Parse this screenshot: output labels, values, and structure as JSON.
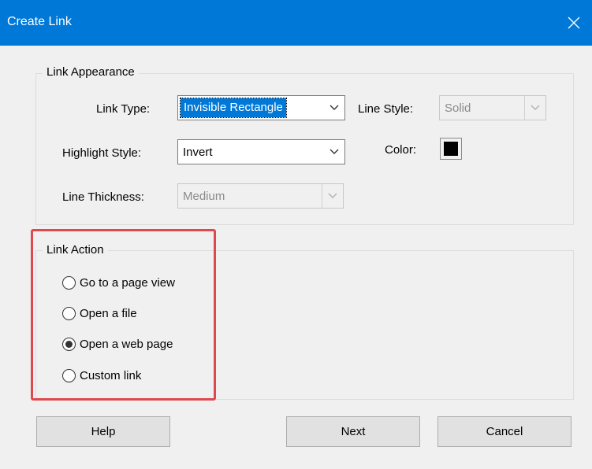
{
  "window": {
    "title": "Create Link"
  },
  "link_appearance": {
    "legend": "Link Appearance",
    "link_type": {
      "label": "Link Type:",
      "value": "Invisible Rectangle"
    },
    "line_style": {
      "label": "Line Style:",
      "value": "Solid",
      "disabled": true
    },
    "highlight_style": {
      "label": "Highlight Style:",
      "value": "Invert"
    },
    "color": {
      "label": "Color:",
      "value": "#000000"
    },
    "line_thickness": {
      "label": "Line Thickness:",
      "value": "Medium",
      "disabled": true
    }
  },
  "link_action": {
    "legend": "Link Action",
    "options": [
      {
        "label": "Go to a page view",
        "selected": false
      },
      {
        "label": "Open a file",
        "selected": false
      },
      {
        "label": "Open a web page",
        "selected": true
      },
      {
        "label": "Custom link",
        "selected": false
      }
    ]
  },
  "buttons": {
    "help": "Help",
    "next": "Next",
    "cancel": "Cancel"
  },
  "colors": {
    "titlebar": "#0078d7",
    "selection": "#0078d7",
    "annotation_box": "#e0484e"
  }
}
